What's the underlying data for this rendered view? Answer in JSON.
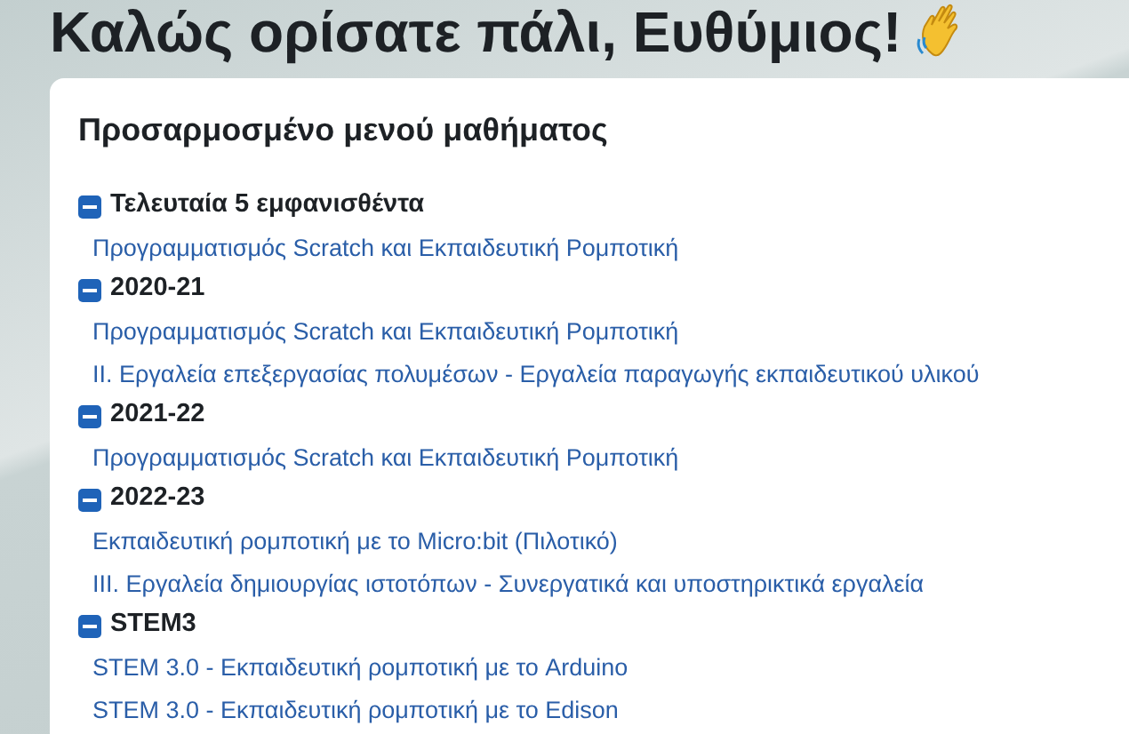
{
  "greeting": "Καλώς ορίσατε πάλι, Ευθύμιος!",
  "card": {
    "title": "Προσαρμοσμένο μενού μαθήματος",
    "groups": [
      {
        "title": "Τελευταία 5 εμφανισθέντα",
        "expanded": true,
        "links": [
          "Προγραμματισμός Scratch και Εκπαιδευτική Ρομποτική"
        ]
      },
      {
        "title": "2020-21",
        "expanded": true,
        "links": [
          "Προγραμματισμός Scratch και Εκπαιδευτική Ρομποτική",
          "II. Εργαλεία επεξεργασίας πολυμέσων - Εργαλεία παραγωγής εκπαιδευτικού υλικού"
        ]
      },
      {
        "title": "2021-22",
        "expanded": true,
        "links": [
          "Προγραμματισμός Scratch και Εκπαιδευτική Ρομποτική"
        ]
      },
      {
        "title": "2022-23",
        "expanded": true,
        "links": [
          "Εκπαιδευτική ρομποτική με το Micro:bit (Πιλοτικό)",
          "III. Εργαλεία δημιουργίας ιστοτόπων - Συνεργατικά και υποστηρικτικά εργαλεία"
        ]
      },
      {
        "title": "STEM3",
        "expanded": true,
        "links": [
          "STEM 3.0 - Εκπαιδευτική ρομποτική με το Arduino",
          "STEM 3.0 - Εκπαιδευτική ρομποτική με το Edison"
        ]
      }
    ]
  }
}
